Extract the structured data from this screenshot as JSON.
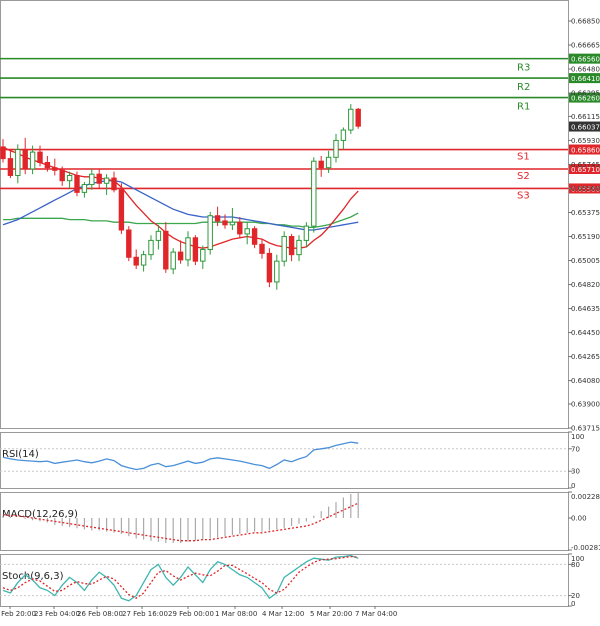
{
  "colors": {
    "bull": "#2e9a3a",
    "bear": "#e0262a",
    "resistance": "#2a8a2a",
    "support": "#e0262a",
    "ma_fast": "#e0262a",
    "ma_mid": "#3a63c8",
    "ma_slow": "#3aa64e",
    "rsi_line": "#4a90d9",
    "macd_bar": "#aaaaaa",
    "macd_signal": "#e0262a",
    "stoch_k": "#3fb5b0",
    "stoch_d": "#e0262a",
    "level_grid": "#c8c8c8",
    "frame": "#9a9a9a",
    "price_tag": "#333333"
  },
  "chart_data": [
    {
      "type": "candlestick",
      "price_axis_ticks": [
        "0.66850",
        "0.66665",
        "0.66480",
        "0.66295",
        "0.66115",
        "0.65930",
        "0.65745",
        "0.65560",
        "0.65375",
        "0.65190",
        "0.65005",
        "0.64820",
        "0.64635",
        "0.64450",
        "0.64265",
        "0.64080",
        "0.63900",
        "0.63715"
      ],
      "ylim": [
        0.63715,
        0.6695
      ],
      "time_axis_ticks": [
        "21 Feb 20:00",
        "23 Feb 04:00",
        "26 Feb 08:00",
        "27 Feb 16:00",
        "29 Feb 00:00",
        "1 Mar 08:00",
        "4 Mar 12:00",
        "5 Mar 20:00",
        "7 Mar 04:00"
      ],
      "current_price": "0.66037",
      "levels": [
        {
          "name": "R3",
          "value": "0.66560",
          "kind": "resistance"
        },
        {
          "name": "R2",
          "value": "0.66410",
          "kind": "resistance"
        },
        {
          "name": "R1",
          "value": "0.66260",
          "kind": "resistance"
        },
        {
          "name": "S1",
          "value": "0.65860",
          "kind": "support"
        },
        {
          "name": "S2",
          "value": "0.65710",
          "kind": "support"
        },
        {
          "name": "S3",
          "value": "0.65560",
          "kind": "support"
        }
      ],
      "candles": [
        [
          0.6588,
          0.6594,
          0.6576,
          0.6579
        ],
        [
          0.6579,
          0.6586,
          0.6564,
          0.6566
        ],
        [
          0.6566,
          0.659,
          0.656,
          0.6586
        ],
        [
          0.6586,
          0.6595,
          0.6567,
          0.6571
        ],
        [
          0.6571,
          0.6589,
          0.6567,
          0.6584
        ],
        [
          0.6584,
          0.6589,
          0.6573,
          0.6576
        ],
        [
          0.6576,
          0.6581,
          0.6569,
          0.6572
        ],
        [
          0.6572,
          0.6579,
          0.6566,
          0.657
        ],
        [
          0.657,
          0.6573,
          0.6558,
          0.6562
        ],
        [
          0.6562,
          0.6569,
          0.6556,
          0.6566
        ],
        [
          0.6566,
          0.6569,
          0.655,
          0.6553
        ],
        [
          0.6553,
          0.6561,
          0.6549,
          0.6559
        ],
        [
          0.6559,
          0.6571,
          0.6555,
          0.6567
        ],
        [
          0.6567,
          0.6571,
          0.6556,
          0.656
        ],
        [
          0.656,
          0.6567,
          0.6551,
          0.6564
        ],
        [
          0.6564,
          0.6569,
          0.6553,
          0.6555
        ],
        [
          0.6555,
          0.656,
          0.6521,
          0.6524
        ],
        [
          0.6524,
          0.6527,
          0.65,
          0.6503
        ],
        [
          0.6503,
          0.6509,
          0.6494,
          0.6497
        ],
        [
          0.6497,
          0.6508,
          0.6492,
          0.6505
        ],
        [
          0.6505,
          0.652,
          0.6501,
          0.6516
        ],
        [
          0.6516,
          0.6528,
          0.6509,
          0.6523
        ],
        [
          0.6523,
          0.653,
          0.6491,
          0.6494
        ],
        [
          0.6494,
          0.651,
          0.649,
          0.6507
        ],
        [
          0.6507,
          0.6516,
          0.6498,
          0.6501
        ],
        [
          0.6501,
          0.6523,
          0.6496,
          0.6518
        ],
        [
          0.6518,
          0.652,
          0.6497,
          0.65
        ],
        [
          0.65,
          0.6512,
          0.6494,
          0.6509
        ],
        [
          0.6509,
          0.6538,
          0.6505,
          0.6535
        ],
        [
          0.6535,
          0.6542,
          0.6527,
          0.6531
        ],
        [
          0.6531,
          0.6536,
          0.6525,
          0.6528
        ],
        [
          0.6528,
          0.6541,
          0.6524,
          0.653
        ],
        [
          0.653,
          0.6534,
          0.6518,
          0.6521
        ],
        [
          0.6521,
          0.653,
          0.6513,
          0.6525
        ],
        [
          0.6525,
          0.6527,
          0.651,
          0.6513
        ],
        [
          0.6513,
          0.6517,
          0.6502,
          0.6506
        ],
        [
          0.6506,
          0.651,
          0.648,
          0.6484
        ],
        [
          0.6484,
          0.6505,
          0.6478,
          0.65
        ],
        [
          0.65,
          0.6523,
          0.6496,
          0.6519
        ],
        [
          0.6519,
          0.6521,
          0.65,
          0.6505
        ],
        [
          0.6505,
          0.652,
          0.65,
          0.6516
        ],
        [
          0.6516,
          0.653,
          0.6511,
          0.6527
        ],
        [
          0.6527,
          0.658,
          0.6522,
          0.6577
        ],
        [
          0.6577,
          0.6581,
          0.6565,
          0.6572
        ],
        [
          0.6572,
          0.6585,
          0.6568,
          0.658
        ],
        [
          0.658,
          0.6598,
          0.6576,
          0.6593
        ],
        [
          0.6593,
          0.6603,
          0.6586,
          0.6601
        ],
        [
          0.6601,
          0.6621,
          0.6598,
          0.6617
        ],
        [
          0.6617,
          0.6618,
          0.6602,
          0.6604
        ]
      ],
      "ma_fast": [
        0.6588,
        0.6585,
        0.6583,
        0.658,
        0.6578,
        0.6576,
        0.6574,
        0.6572,
        0.657,
        0.6568,
        0.6566,
        0.6565,
        0.6565,
        0.6564,
        0.6563,
        0.6562,
        0.6557,
        0.655,
        0.6543,
        0.6537,
        0.6531,
        0.6527,
        0.6522,
        0.6518,
        0.6515,
        0.6513,
        0.6511,
        0.651,
        0.6511,
        0.6513,
        0.6515,
        0.6517,
        0.6518,
        0.6519,
        0.6518,
        0.6517,
        0.6514,
        0.6512,
        0.6511,
        0.651,
        0.651,
        0.6511,
        0.6516,
        0.652,
        0.6526,
        0.6533,
        0.654,
        0.6548,
        0.6554
      ],
      "ma_mid": [
        0.6528,
        0.653,
        0.6532,
        0.6535,
        0.6538,
        0.6541,
        0.6544,
        0.6547,
        0.655,
        0.6553,
        0.6556,
        0.6558,
        0.656,
        0.6561,
        0.6562,
        0.6562,
        0.6561,
        0.6558,
        0.6555,
        0.6552,
        0.6549,
        0.6546,
        0.6543,
        0.654,
        0.6538,
        0.6536,
        0.6535,
        0.6534,
        0.6534,
        0.6534,
        0.6534,
        0.6534,
        0.6533,
        0.6532,
        0.6531,
        0.653,
        0.6529,
        0.6528,
        0.6527,
        0.6526,
        0.6525,
        0.6524,
        0.6524,
        0.6525,
        0.6526,
        0.6527,
        0.6528,
        0.6529,
        0.653
      ],
      "ma_slow": [
        0.6532,
        0.6532,
        0.6533,
        0.6533,
        0.6533,
        0.6533,
        0.6533,
        0.6533,
        0.6533,
        0.6532,
        0.6532,
        0.6532,
        0.6531,
        0.6531,
        0.6531,
        0.653,
        0.653,
        0.653,
        0.6529,
        0.6529,
        0.6529,
        0.6529,
        0.6529,
        0.6529,
        0.6529,
        0.6529,
        0.6529,
        0.653,
        0.653,
        0.653,
        0.653,
        0.653,
        0.653,
        0.653,
        0.653,
        0.6529,
        0.6529,
        0.6528,
        0.6528,
        0.6527,
        0.6527,
        0.6526,
        0.6526,
        0.6527,
        0.6528,
        0.653,
        0.6532,
        0.6534,
        0.6537
      ]
    },
    {
      "type": "line",
      "title": "RSI(14)",
      "y_ticks": [
        "100",
        "70",
        "30",
        "0"
      ],
      "ylim": [
        0,
        100
      ],
      "levels": [
        70,
        30
      ],
      "values": [
        55,
        52,
        50,
        49,
        48,
        47,
        48,
        44,
        46,
        48,
        50,
        47,
        45,
        48,
        52,
        49,
        40,
        36,
        33,
        35,
        41,
        44,
        38,
        40,
        44,
        48,
        44,
        46,
        52,
        54,
        52,
        50,
        48,
        45,
        42,
        40,
        35,
        42,
        50,
        47,
        52,
        56,
        68,
        70,
        72,
        76,
        79,
        82,
        80
      ]
    },
    {
      "type": "bar",
      "title": "MACD(12,26,9)",
      "y_ticks": [
        "0.002284",
        "0.00",
        "-0.002813"
      ],
      "ylim": [
        -0.002813,
        0.002284
      ],
      "values": [
        0.0002,
        0.0001,
        0.0,
        -0.0001,
        -0.0002,
        -0.0003,
        -0.0004,
        -0.0006,
        -0.0007,
        -0.0008,
        -0.0009,
        -0.001,
        -0.0011,
        -0.0011,
        -0.0012,
        -0.0013,
        -0.0014,
        -0.0016,
        -0.0018,
        -0.0019,
        -0.002,
        -0.0021,
        -0.0022,
        -0.0022,
        -0.0022,
        -0.0021,
        -0.002,
        -0.0019,
        -0.0018,
        -0.0017,
        -0.0016,
        -0.0015,
        -0.0014,
        -0.0013,
        -0.0012,
        -0.0012,
        -0.0011,
        -0.001,
        -0.0009,
        -0.0007,
        -0.0005,
        -0.0003,
        0.0002,
        0.0006,
        0.001,
        0.0014,
        0.0018,
        0.0021,
        0.0023
      ],
      "signal": [
        0.0003,
        0.0002,
        0.0002,
        0.0001,
        0.0,
        -0.0001,
        -0.0002,
        -0.0003,
        -0.0004,
        -0.0005,
        -0.0006,
        -0.0007,
        -0.0008,
        -0.0009,
        -0.001,
        -0.0011,
        -0.0012,
        -0.0013,
        -0.0014,
        -0.0015,
        -0.0016,
        -0.0017,
        -0.0018,
        -0.0019,
        -0.002,
        -0.002,
        -0.002,
        -0.0019,
        -0.0019,
        -0.0018,
        -0.0017,
        -0.0016,
        -0.0015,
        -0.0014,
        -0.0013,
        -0.0013,
        -0.0012,
        -0.0011,
        -0.001,
        -0.0009,
        -0.0008,
        -0.0007,
        -0.0005,
        -0.0002,
        0.0001,
        0.0004,
        0.0007,
        0.001,
        0.0013
      ]
    },
    {
      "type": "line",
      "title": "Stoch(9,6,3)",
      "y_ticks": [
        "100",
        "80",
        "20",
        "0"
      ],
      "ylim": [
        0,
        100
      ],
      "levels": [
        80,
        20
      ],
      "k": [
        30,
        25,
        45,
        60,
        50,
        35,
        30,
        20,
        40,
        55,
        45,
        30,
        50,
        65,
        55,
        40,
        15,
        10,
        20,
        45,
        70,
        80,
        55,
        40,
        55,
        75,
        60,
        45,
        70,
        85,
        80,
        70,
        60,
        55,
        45,
        35,
        15,
        25,
        55,
        65,
        75,
        85,
        92,
        90,
        88,
        94,
        95,
        97,
        92
      ],
      "d": [
        35,
        30,
        35,
        45,
        52,
        48,
        38,
        28,
        30,
        40,
        47,
        43,
        42,
        50,
        57,
        52,
        37,
        22,
        15,
        25,
        45,
        65,
        68,
        58,
        50,
        57,
        63,
        60,
        58,
        67,
        78,
        78,
        70,
        62,
        53,
        45,
        32,
        25,
        32,
        48,
        65,
        75,
        84,
        89,
        90,
        91,
        93,
        95,
        94
      ]
    }
  ]
}
